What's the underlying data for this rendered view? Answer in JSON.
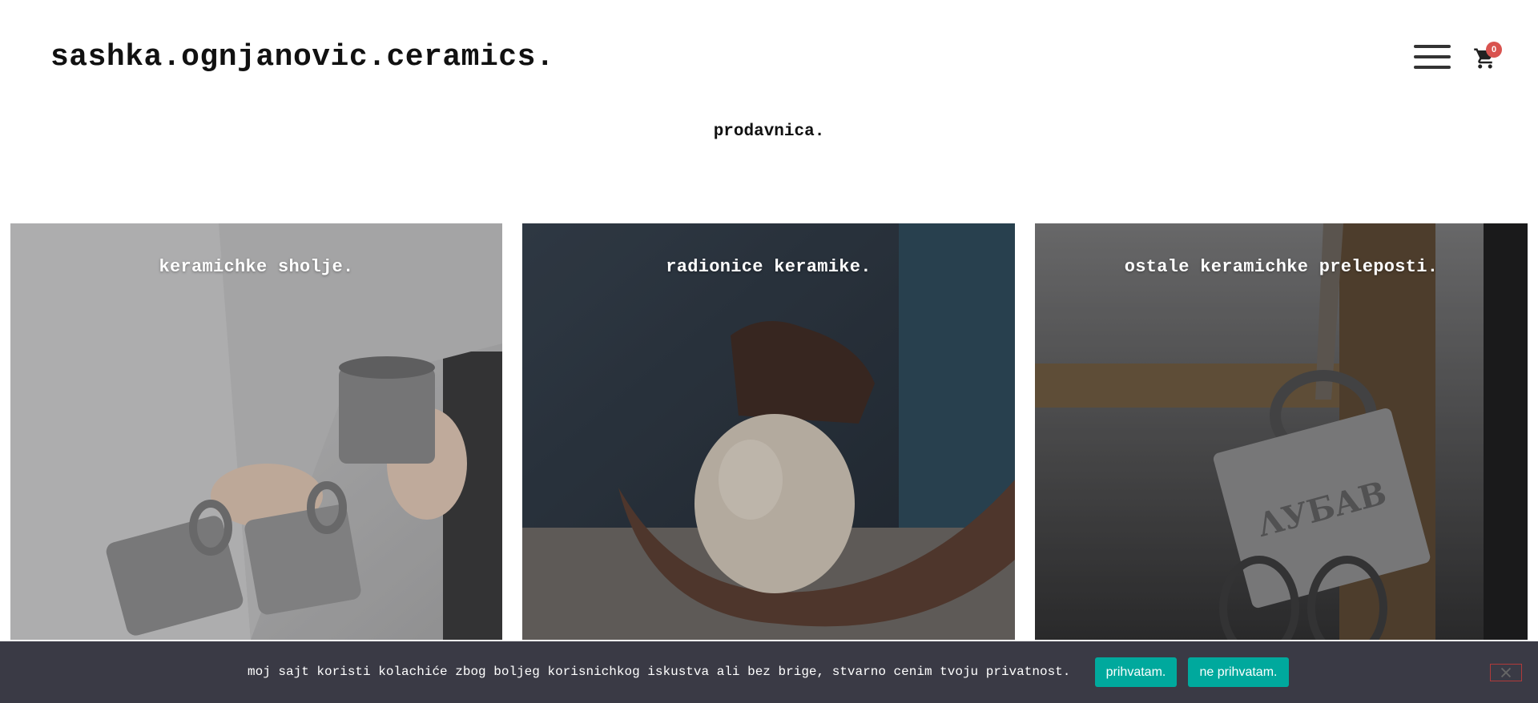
{
  "header": {
    "logo": "sashka.ognjanovic.ceramics.",
    "menu_icon": "hamburger-menu-icon",
    "cart_icon": "shopping-cart-icon",
    "cart_count": "0"
  },
  "page": {
    "title": "prodavnica."
  },
  "categories": [
    {
      "title": "keramichke sholje."
    },
    {
      "title": "radionice keramike."
    },
    {
      "title": "ostale keramichke prelepostі."
    }
  ],
  "cookie_bar": {
    "message": "moj sajt koristi kolachiće zbog boljeg korisnichkog iskustva ali bez brige, stvarno cenim tvoju privatnost.",
    "accept_label": "prihvatam.",
    "decline_label": "ne prihvatam.",
    "close_icon": "close-icon"
  },
  "colors": {
    "accent": "#00a99d",
    "cookie_bg": "#3a3a45",
    "badge": "#d9534f"
  }
}
